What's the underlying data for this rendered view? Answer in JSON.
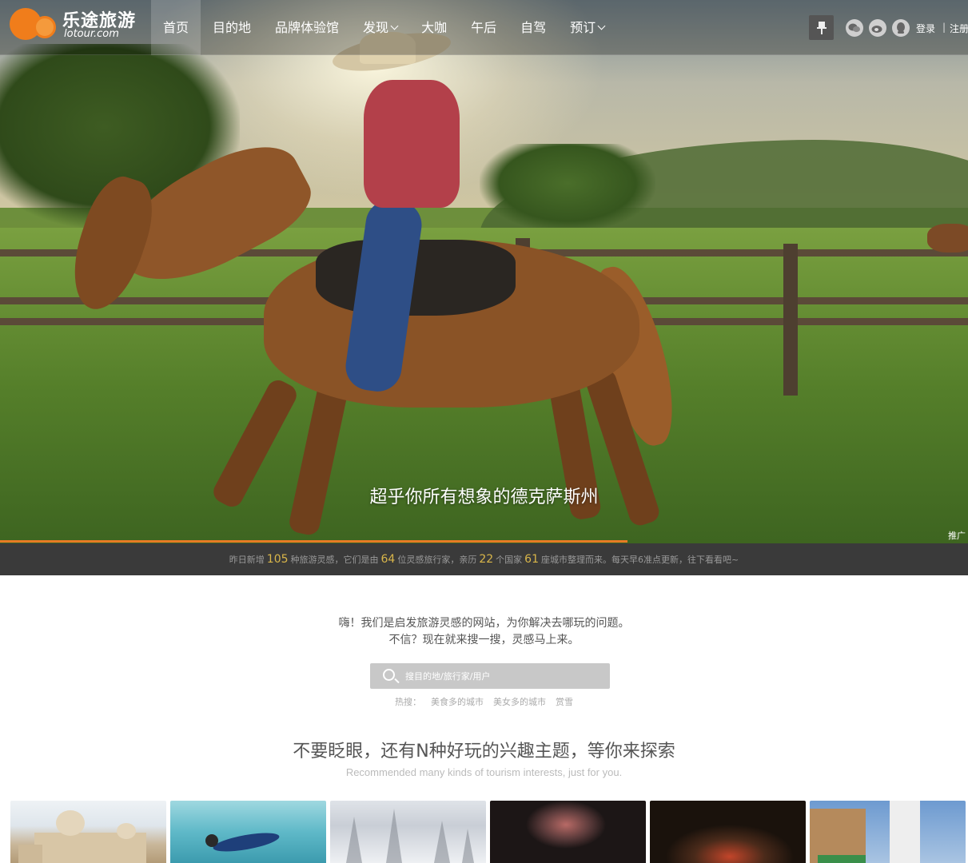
{
  "brand": {
    "name_cn": "乐途旅游",
    "name_en": "lotour.com"
  },
  "nav": [
    {
      "label": "首页",
      "active": true,
      "dropdown": false
    },
    {
      "label": "目的地",
      "active": false,
      "dropdown": false
    },
    {
      "label": "品牌体验馆",
      "active": false,
      "dropdown": false
    },
    {
      "label": "发现",
      "active": false,
      "dropdown": true
    },
    {
      "label": "大咖",
      "active": false,
      "dropdown": false
    },
    {
      "label": "午后",
      "active": false,
      "dropdown": false
    },
    {
      "label": "自驾",
      "active": false,
      "dropdown": false
    },
    {
      "label": "预订",
      "active": false,
      "dropdown": true
    }
  ],
  "header_icons": [
    "pin-icon",
    "wechat-icon",
    "weibo-icon",
    "qq-icon"
  ],
  "auth": {
    "login": "登录",
    "separator": "|",
    "register": "注册"
  },
  "hero": {
    "caption": "超乎你所有想象的德克萨斯州",
    "ad_tag": "推广"
  },
  "stats": {
    "t1": "昨日新增",
    "n1": "105",
    "t2": "种旅游灵感，它们是由",
    "n2": "64",
    "t3": "位灵感旅行家，亲历",
    "n3": "22",
    "t4": "个国家",
    "n4": "61",
    "t5": "座城市整理而来。每天早6准点更新，往下看看吧~"
  },
  "intro": {
    "line1": "嗨！我们是启发旅游灵感的网站，为你解决去哪玩的问题。",
    "line2": "不信？现在就来搜一搜，灵感马上来。"
  },
  "search": {
    "placeholder": "搜目的地/旅行家/用户"
  },
  "hot": {
    "label": "热搜：",
    "items": [
      "美食多的城市",
      "美女多的城市",
      "赏雪"
    ]
  },
  "interests": {
    "title": "不要眨眼，还有N种好玩的兴趣主题，等你来探索",
    "subtitle": "Recommended many kinds of tourism interests, just for you."
  },
  "colors": {
    "accent": "#e77a25",
    "stat_number": "#d9b64a",
    "stats_bg": "#3a3a3a"
  }
}
